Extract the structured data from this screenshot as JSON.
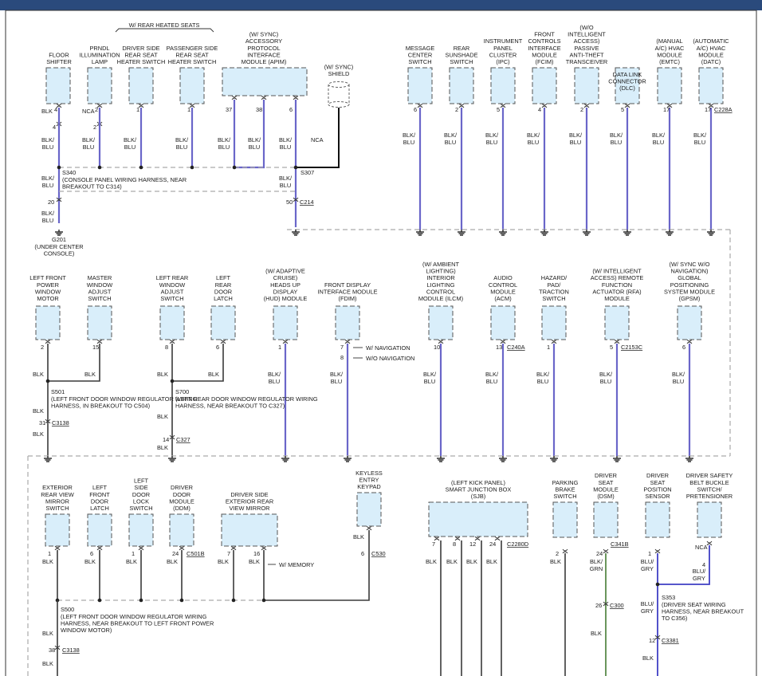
{
  "title_bar_color": "#2a4a7c",
  "wire_colors": {
    "blk_blu": "#6a66c9",
    "blk": "#3a3a3a",
    "nca": "#111111",
    "blk_grn": "#5a8a4a",
    "blu_gry": "#3f3fc4"
  },
  "section1": {
    "group_label": "W/ REAR HEATED SEATS",
    "components": [
      {
        "name": "FLOOR SHIFTER",
        "pin": "4",
        "wire": "BLK"
      },
      {
        "name": "PRNDL ILLUMINATION LAMP",
        "pin": "2",
        "wire": "NCA"
      },
      {
        "name": "DRIVER SIDE REAR SEAT HEATER SWITCH",
        "pin": "1"
      },
      {
        "name": "PASSENGER SIDE REAR SEAT HEATER SWITCH",
        "pin": "1"
      },
      {
        "name": "(W/ SYNC) ACCESSORY PROTOCOL INTERFACE MODULE (APIM)",
        "pins": [
          "37",
          "38",
          "6"
        ]
      },
      {
        "name": "(W/ SYNC) SHIELD",
        "wire": "NCA"
      }
    ],
    "wire_label": "BLK/ BLU",
    "s340": "S340",
    "s340_desc": "(CONSOLE PANEL WIRING HARNESS, NEAR BREAKOUT TO C314)",
    "s340_pin": "20",
    "s307": "S307",
    "c214_pin": "50",
    "c214": "C214",
    "g201": "G201",
    "g201_desc": "(UNDER CENTER CONSOLE)"
  },
  "section2": {
    "components": [
      {
        "name": "MESSAGE CENTER SWITCH",
        "pin": "6"
      },
      {
        "name": "REAR SUNSHADE SWITCH",
        "pin": "2"
      },
      {
        "name": "INSTRUMENT PANEL CLUSTER (IPC)",
        "pin": "5"
      },
      {
        "name": "FRONT CONTROLS INTERFACE MODULE (FCIM)",
        "pin": "4"
      },
      {
        "name": "(W/O INTELLIGENT ACCESS) PASSIVE ANTI-THEFT TRANSCEIVER",
        "pin": "2"
      },
      {
        "name": "DATA LINK CONNECTOR (DLC)",
        "pin": "5"
      },
      {
        "name": "(MANUAL A/C) HVAC MODULE (EMTC)",
        "pin": "17"
      },
      {
        "name": "(AUTOMATIC A/C) HVAC MODULE (DATC)",
        "pin": "17",
        "connector": "C228A"
      }
    ]
  },
  "section3": {
    "components": [
      {
        "name": "LEFT FRONT POWER WINDOW MOTOR",
        "pin": "2"
      },
      {
        "name": "MASTER WINDOW ADJUST SWITCH",
        "pin": "15"
      },
      {
        "name": "LEFT REAR WINDOW ADJUST SWITCH",
        "pin": "8"
      },
      {
        "name": "LEFT REAR DOOR LATCH",
        "pin": "6"
      },
      {
        "name": "(W/ ADAPTIVE CRUISE) HEADS UP DISPLAY (HUD) MODULE",
        "pin": "1"
      },
      {
        "name": "FRONT DISPLAY INTERFACE MODULE (FDIM)",
        "pins": [
          "7",
          "8"
        ],
        "notes": [
          "W/ NAVIGATION",
          "W/O NAVIGATION"
        ]
      },
      {
        "name": "(W/ AMBIENT LIGHTING) INTERIOR LIGHTING CONTROL MODULE (ILCM)",
        "pin": "10"
      },
      {
        "name": "AUDIO CONTROL MODULE (ACM)",
        "pin": "13",
        "connector": "C240A"
      },
      {
        "name": "HAZARD/ PAD/ TRACTION SWITCH",
        "pin": "1"
      },
      {
        "name": "(W/ INTELLIGENT ACCESS) REMOTE FUNCTION ACTUATOR (RFA) MODULE",
        "pin": "5",
        "connector": "C2153C"
      },
      {
        "name": "(W/ SYNC W/O NAVIGATION) GLOBAL POSITIONING SYSTEM MODULE (GPSM)",
        "pin": "6"
      }
    ],
    "s501": "S501",
    "s501_desc": "(LEFT FRONT DOOR WINDOW REGULATOR WIRING HARNESS, IN BREAKOUT TO C504)",
    "s501_pin": "31",
    "c3138": "C3138",
    "s700": "S700",
    "s700_desc": "(LEFT REAR DOOR WINDOW REGULATOR WIRING HARNESS, NEAR BREAKOUT TO C327)",
    "s700_pin": "14",
    "c327": "C327"
  },
  "section4": {
    "components": [
      {
        "name": "EXTERIOR REAR VIEW MIRROR SWITCH",
        "pin": "1"
      },
      {
        "name": "LEFT FRONT DOOR LATCH",
        "pin": "6"
      },
      {
        "name": "LEFT SIDE DOOR LOCK SWITCH",
        "pin": "1"
      },
      {
        "name": "DRIVER DOOR MODULE (DDM)",
        "pin": "24",
        "connector": "C501B"
      },
      {
        "name": "DRIVER SIDE EXTERIOR REAR VIEW MIRROR",
        "pins": [
          "7",
          "16"
        ],
        "note": "W/ MEMORY"
      },
      {
        "name": "KEYLESS ENTRY KEYPAD",
        "pin": "6",
        "connector": "C530"
      },
      {
        "name": "(LEFT KICK PANEL) SMART JUNCTION BOX (SJB)",
        "pins": [
          "7",
          "8",
          "12",
          "24"
        ],
        "connector": "C2280D"
      },
      {
        "name": "PARKING BRAKE SWITCH",
        "pin": "2"
      },
      {
        "name": "DRIVER SEAT MODULE (DSM)",
        "pin": "24",
        "connector": "C341B"
      },
      {
        "name": "DRIVER SEAT POSITION SENSOR",
        "pin": "1"
      },
      {
        "name": "DRIVER SAFETY BELT BUCKLE SWITCH/ PRETENSIONER",
        "pin": "4",
        "wire": "NCA"
      }
    ],
    "s500": "S500",
    "s500_desc": "(LEFT FRONT DOOR WINDOW REGULATOR WIRING HARNESS, NEAR BREAKOUT TO LEFT FRONT POWER WINDOW MOTOR)",
    "s500_pin": "38",
    "c300_pin": "26",
    "c300": "C300",
    "s353": "S353",
    "s353_desc": "(DRIVER SEAT WIRING HARNESS, NEAR BREAKOUT TO C356)",
    "c3381_pin": "12",
    "c3381": "C3381"
  },
  "wire_text": {
    "blk": "BLK",
    "nca": "NCA",
    "blk_blu": "BLK/ BLU",
    "blk_grn": "BLK/ GRN",
    "blu_gry": "BLU/ GRY"
  }
}
